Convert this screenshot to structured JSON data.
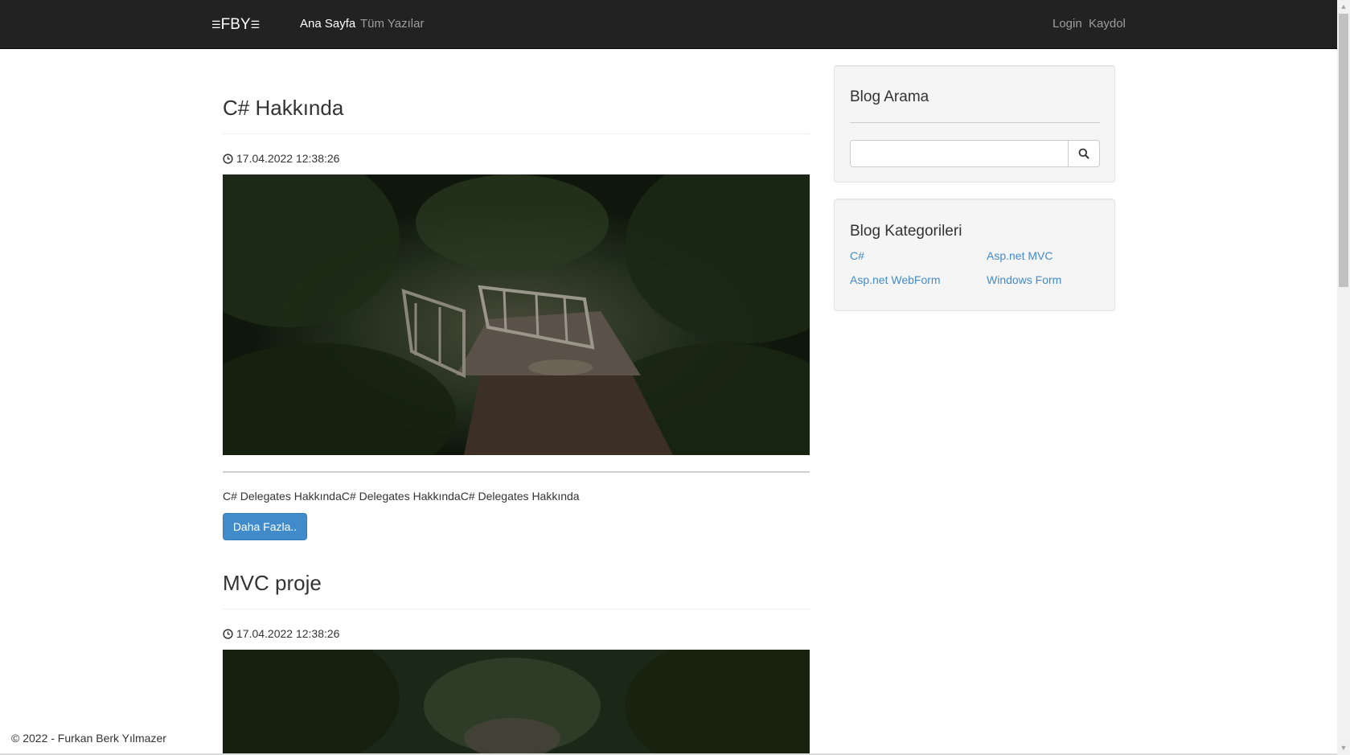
{
  "navbar": {
    "brand_left_icon": "menu-lines-icon",
    "brand": "FBY",
    "brand_right_icon": "menu-lines-icon",
    "links": [
      {
        "label": "Ana Sayfa",
        "active": true
      },
      {
        "label": "Tüm Yazılar",
        "active": false
      }
    ],
    "login": "Login",
    "register": "Kaydol",
    "bg_color": "#222222"
  },
  "posts": [
    {
      "title": "C# Hakkında",
      "date": "17.04.2022 12:38:26",
      "image_icon": "forest-bridge-image",
      "excerpt": "C# Delegates HakkındaC# Delegates HakkındaC# Delegates Hakkında",
      "button": "Daha Fazla.."
    },
    {
      "title": "MVC proje",
      "date": "17.04.2022 12:38:26",
      "image_icon": "forest-bridge-image"
    }
  ],
  "sidebar": {
    "search": {
      "title": "Blog Arama",
      "value": "",
      "button_icon": "search-icon"
    },
    "categories": {
      "title": "Blog Kategorileri",
      "items": [
        "C#",
        "Asp.net MVC",
        "Asp.net WebForm",
        "Windows Form"
      ]
    }
  },
  "footer": {
    "text": "© 2022 - Furkan Berk Yılmazer"
  },
  "colors": {
    "link": "#428bca",
    "button": "#428bca"
  }
}
